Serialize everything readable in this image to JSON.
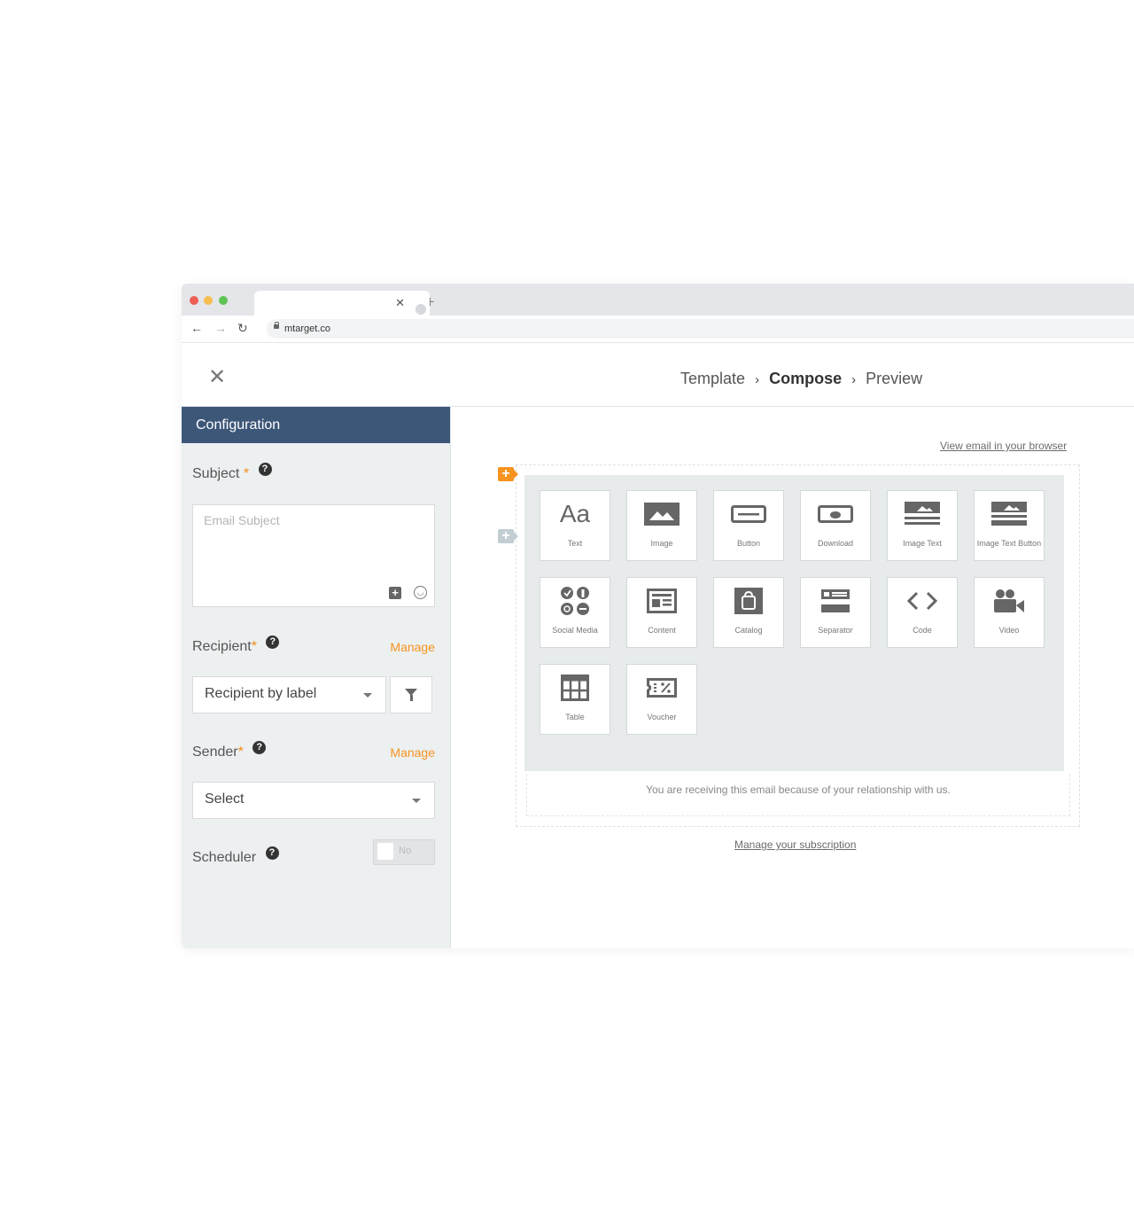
{
  "browser": {
    "url": "mtarget.co",
    "window_controls": [
      "close-dot",
      "minimize-dot",
      "maximize-dot"
    ],
    "colors": {
      "close": "#ed5f55",
      "minimize": "#f5be4f",
      "maximize": "#5fc454"
    }
  },
  "header": {
    "close_symbol": "✕",
    "breadcrumb": {
      "step1": "Template",
      "step2": "Compose",
      "step3": "Preview",
      "separator": "›"
    }
  },
  "sidebar": {
    "title": "Configuration",
    "subject": {
      "label": "Subject",
      "required": "*",
      "placeholder": "Email Subject"
    },
    "recipient": {
      "label": "Recipient",
      "required": "*",
      "manage": "Manage",
      "value": "Recipient by label"
    },
    "sender": {
      "label": "Sender",
      "required": "*",
      "manage": "Manage",
      "value": "Select"
    },
    "scheduler": {
      "label": "Scheduler",
      "toggle_state": "No"
    },
    "help_symbol": "?"
  },
  "canvas": {
    "view_in_browser": "View email in your browser",
    "blocks": [
      {
        "label": "Text",
        "icon": "text-icon"
      },
      {
        "label": "Image",
        "icon": "image-icon"
      },
      {
        "label": "Button",
        "icon": "button-icon"
      },
      {
        "label": "Download",
        "icon": "download-icon"
      },
      {
        "label": "Image Text",
        "icon": "image-text-icon"
      },
      {
        "label": "Image Text Button",
        "icon": "image-text-button-icon"
      },
      {
        "label": "Social Media",
        "icon": "social-media-icon"
      },
      {
        "label": "Content",
        "icon": "content-icon"
      },
      {
        "label": "Catalog",
        "icon": "catalog-icon"
      },
      {
        "label": "Separator",
        "icon": "separator-icon"
      },
      {
        "label": "Code",
        "icon": "code-icon"
      },
      {
        "label": "Video",
        "icon": "video-icon"
      },
      {
        "label": "Table",
        "icon": "table-icon"
      },
      {
        "label": "Voucher",
        "icon": "voucher-icon"
      }
    ],
    "text_glyph": "Aa",
    "footer_text": "You are receiving this email because of your relationship with us.",
    "manage_subscription": "Manage your subscription",
    "add_symbol": "+",
    "accent_color": "#f7931e"
  }
}
